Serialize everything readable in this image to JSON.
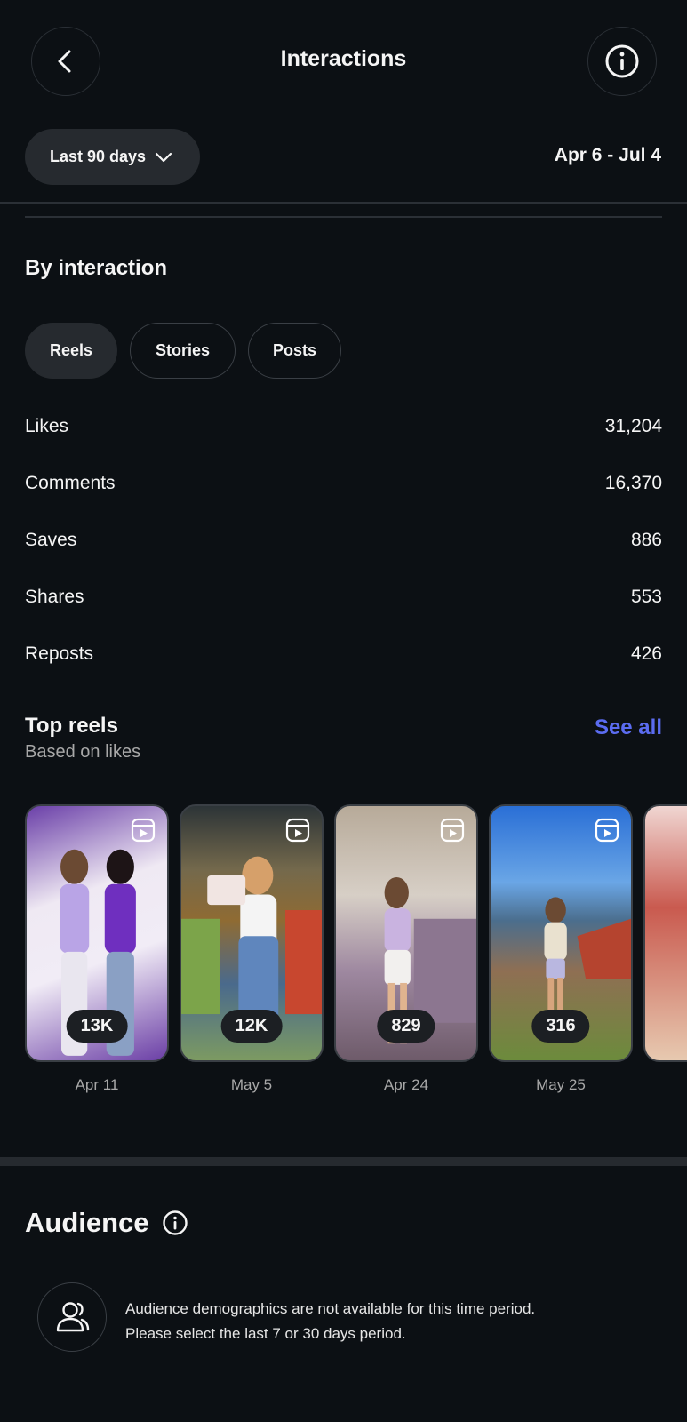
{
  "header": {
    "title": "Interactions",
    "back_icon": "chevron-left-icon",
    "info_icon": "info-circle-icon"
  },
  "filter": {
    "range_label": "Last 90 days",
    "dropdown_icon": "chevron-down-icon",
    "date_range": "Apr 6 - Jul 4"
  },
  "by_interaction": {
    "title": "By interaction",
    "tabs": [
      {
        "label": "Reels",
        "active": true
      },
      {
        "label": "Stories",
        "active": false
      },
      {
        "label": "Posts",
        "active": false
      }
    ],
    "metrics": [
      {
        "label": "Likes",
        "value": "31,204"
      },
      {
        "label": "Comments",
        "value": "16,370"
      },
      {
        "label": "Saves",
        "value": "886"
      },
      {
        "label": "Shares",
        "value": "553"
      },
      {
        "label": "Reposts",
        "value": "426"
      }
    ]
  },
  "top_reels": {
    "title": "Top reels",
    "subtitle": "Based on likes",
    "see_all": "See all",
    "items": [
      {
        "count": "13K",
        "date": "Apr 11"
      },
      {
        "count": "12K",
        "date": "May 5"
      },
      {
        "count": "829",
        "date": "Apr 24"
      },
      {
        "count": "316",
        "date": "May 25"
      }
    ]
  },
  "audience": {
    "title": "Audience",
    "message_line1": "Audience demographics are not available for this time period.",
    "message_line2": "Please select the last 7 or 30 days period."
  },
  "colors": {
    "background": "#0c1014",
    "surface": "#262a2f",
    "accent_link": "#5b6cf0",
    "muted_text": "#a8a8a8"
  }
}
